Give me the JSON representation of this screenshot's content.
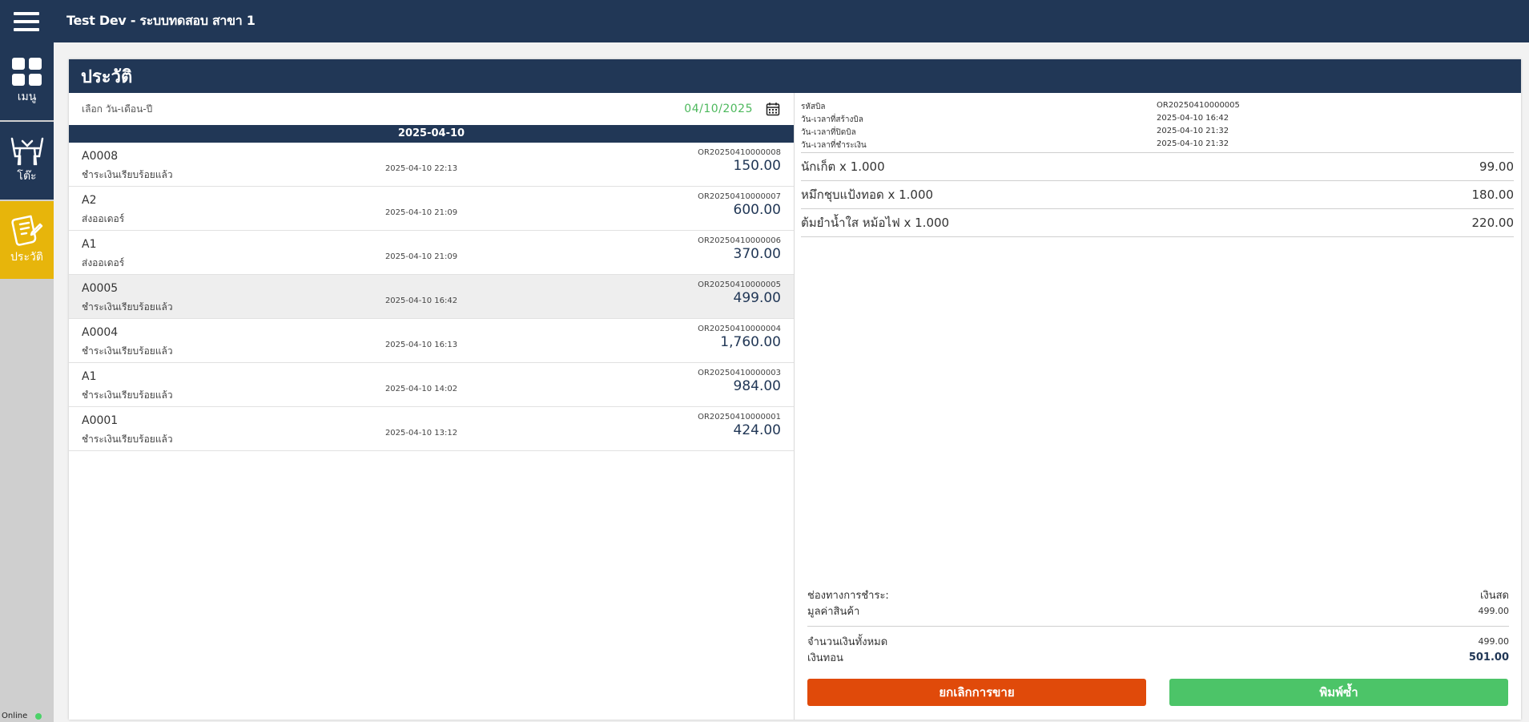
{
  "app": {
    "title": "Test Dev - ระบบทดสอบ สาขา 1"
  },
  "sidebar": {
    "items": [
      {
        "label": "เมนู",
        "icon": "grid-icon"
      },
      {
        "label": "โต๊ะ",
        "icon": "table-icon"
      },
      {
        "label": "ประวัติ",
        "icon": "history-icon"
      }
    ],
    "status": "Online"
  },
  "page": {
    "title": "ประวัติ",
    "date_label": "เลือก วัน-เดือน-ปี",
    "date_value": "04/10/2025",
    "day_header": "2025-04-10"
  },
  "orders": [
    {
      "table": "A0008",
      "status": "ชำระเงินเรียบร้อยแล้ว",
      "time": "2025-04-10 22:13",
      "order_no": "OR20250410000008",
      "amount": "150.00"
    },
    {
      "table": "A2",
      "status": "ส่งออเดอร์",
      "time": "2025-04-10 21:09",
      "order_no": "OR20250410000007",
      "amount": "600.00"
    },
    {
      "table": "A1",
      "status": "ส่งออเดอร์",
      "time": "2025-04-10 21:09",
      "order_no": "OR20250410000006",
      "amount": "370.00"
    },
    {
      "table": "A0005",
      "status": "ชำระเงินเรียบร้อยแล้ว",
      "time": "2025-04-10 16:42",
      "order_no": "OR20250410000005",
      "amount": "499.00"
    },
    {
      "table": "A0004",
      "status": "ชำระเงินเรียบร้อยแล้ว",
      "time": "2025-04-10 16:13",
      "order_no": "OR20250410000004",
      "amount": "1,760.00"
    },
    {
      "table": "A1",
      "status": "ชำระเงินเรียบร้อยแล้ว",
      "time": "2025-04-10 14:02",
      "order_no": "OR20250410000003",
      "amount": "984.00"
    },
    {
      "table": "A0001",
      "status": "ชำระเงินเรียบร้อยแล้ว",
      "time": "2025-04-10 13:12",
      "order_no": "OR20250410000001",
      "amount": "424.00"
    }
  ],
  "selected_order_index": 3,
  "detail": {
    "meta": [
      {
        "key": "รหัสบิล",
        "value": "OR20250410000005"
      },
      {
        "key": "วัน-เวลาที่สร้างบิล",
        "value": "2025-04-10 16:42"
      },
      {
        "key": "วัน-เวลาที่ปิดบิล",
        "value": "2025-04-10 21:32"
      },
      {
        "key": "วัน-เวลาที่ชำระเงิน",
        "value": "2025-04-10 21:32"
      }
    ],
    "items": [
      {
        "name": "นักเก็ต x 1.000",
        "price": "99.00"
      },
      {
        "name": "หมึกชุบแป้งทอด x 1.000",
        "price": "180.00"
      },
      {
        "name": "ต้มยำน้ำใส หม้อไฟ x 1.000",
        "price": "220.00"
      }
    ],
    "payment_label": "ช่องทางการชำระ:",
    "payment_value": "เงินสด",
    "subtotal_label": "มูลค่าสินค้า",
    "subtotal_value": "499.00",
    "total_label": "จำนวนเงินทั้งหมด",
    "total_value": "499.00",
    "change_label": "เงินทอน",
    "change_value": "501.00",
    "cancel_button": "ยกเลิกการขาย",
    "reprint_button": "พิมพ์ซ้ำ"
  },
  "colors": {
    "navy": "#213756",
    "active_yellow": "#e7b50b",
    "cancel_orange": "#e04a0a",
    "reprint_green": "#4cc468",
    "date_green": "#4cb85c"
  }
}
